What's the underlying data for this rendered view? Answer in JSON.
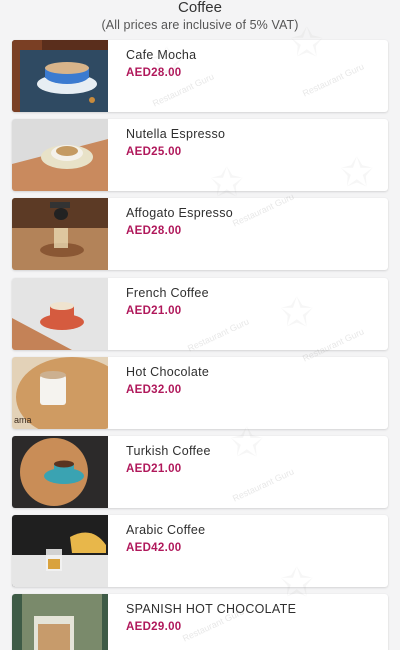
{
  "header": {
    "title": "Coffee",
    "subtitle": "(All prices are inclusive of 5% VAT)"
  },
  "items": [
    {
      "name": "Cafe Mocha",
      "price": "AED28.00"
    },
    {
      "name": "Nutella Espresso",
      "price": "AED25.00"
    },
    {
      "name": "Affogato Espresso",
      "price": "AED28.00"
    },
    {
      "name": "French Coffee",
      "price": "AED21.00"
    },
    {
      "name": "Hot Chocolate",
      "price": "AED32.00"
    },
    {
      "name": "Turkish Coffee",
      "price": "AED21.00"
    },
    {
      "name": "Arabic Coffee",
      "price": "AED42.00"
    },
    {
      "name": "SPANISH HOT CHOCOLATE",
      "price": "AED29.00"
    }
  ],
  "watermark": "Restaurant Guru",
  "colors": {
    "price": "#b0185b",
    "background": "#f4f4f5"
  }
}
